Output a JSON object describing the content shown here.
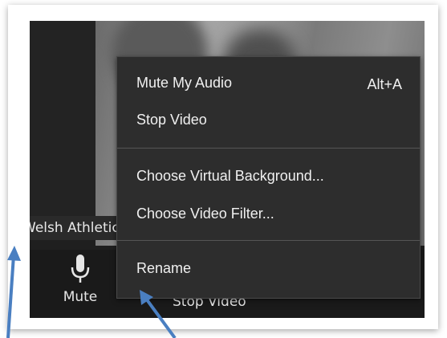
{
  "participant": {
    "name": "Welsh Athletics"
  },
  "menu": {
    "items": [
      {
        "label": "Mute My Audio",
        "shortcut": "Alt+A"
      },
      {
        "label": "Stop Video"
      },
      {
        "label": "Choose Virtual Background..."
      },
      {
        "label": "Choose Video Filter..."
      },
      {
        "label": "Rename"
      }
    ]
  },
  "toolbar": {
    "mute_label": "Mute",
    "stop_video_label": "Stop Video"
  },
  "icons": {
    "mute": "microphone-icon",
    "annotation": "arrow-icon"
  },
  "colors": {
    "annotation_arrow": "#4a7fc1",
    "menu_bg": "#2d2d2d",
    "toolbar_bg": "#1a1a1a"
  }
}
